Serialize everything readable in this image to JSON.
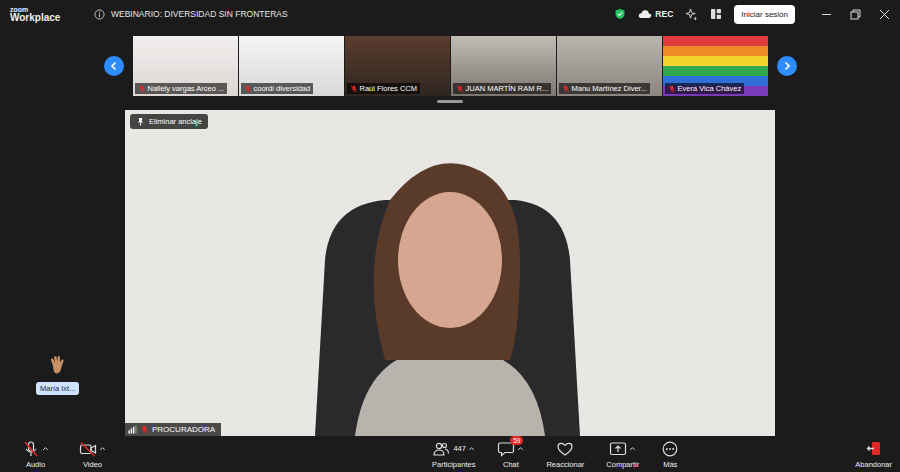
{
  "window": {
    "app": "zoom",
    "app_sub": "Workplace",
    "title": "WEBINARIO: DIVERSIDAD SIN FRONTERAS",
    "recording": true,
    "rec_label": "REC",
    "signin_button": "Iniciar sesión"
  },
  "filmstrip": {
    "participants": [
      {
        "name": "Nallely vargas Arceo ...",
        "muted": true
      },
      {
        "name": "coordi diversidad",
        "muted": true
      },
      {
        "name": "Raúl Flores CCM",
        "muted": true
      },
      {
        "name": "JUAN MARTÍN RAM R...",
        "muted": true
      },
      {
        "name": "Manu Martínez Diver...",
        "muted": true
      },
      {
        "name": "Evera Vica Chávez",
        "muted": true
      }
    ]
  },
  "main_video": {
    "pin_button": "Eliminar anclaje",
    "speaker": "PROCURADORA",
    "muted": true
  },
  "floating_tile": {
    "name": "María Ixt..."
  },
  "toolbar": {
    "left": [
      {
        "label": "Audio",
        "kind": "audio",
        "muted": true
      },
      {
        "label": "Video",
        "kind": "video",
        "muted": true
      }
    ],
    "center": [
      {
        "label": "Participantes",
        "kind": "participants",
        "count": "447"
      },
      {
        "label": "Chat",
        "kind": "chat",
        "badge": "59"
      },
      {
        "label": "Reaccionar",
        "kind": "react"
      },
      {
        "label": "Compartir",
        "kind": "share"
      },
      {
        "label": "Más",
        "kind": "more"
      }
    ],
    "leave": "Abandonar"
  }
}
